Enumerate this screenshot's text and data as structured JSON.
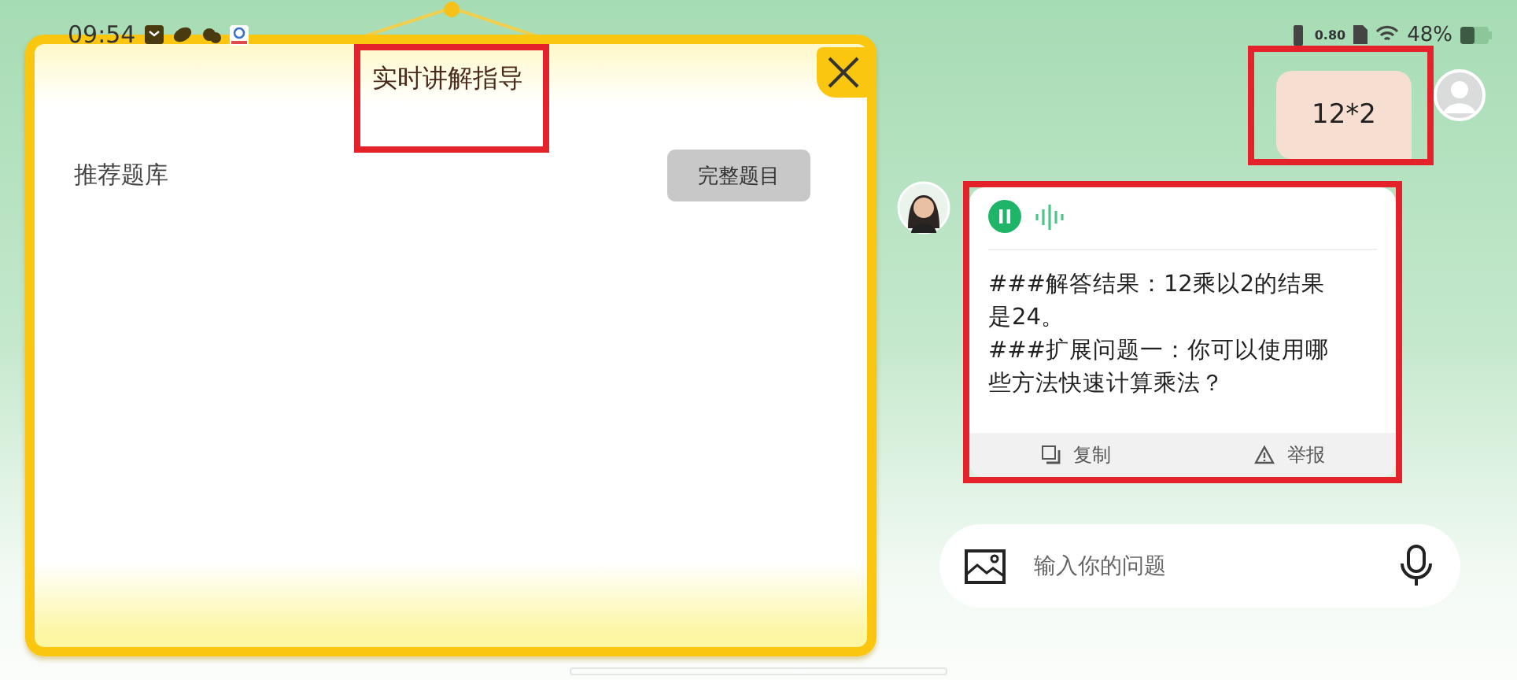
{
  "status_bar": {
    "time": "09:54",
    "speed": "0.80",
    "battery": "48%"
  },
  "popup": {
    "title": "实时讲解指导",
    "title_highlighted": true,
    "section_label": "推荐题库",
    "button": "完整题目"
  },
  "messages": [
    {
      "kind": "user",
      "text": "12*2",
      "highlighted": true
    },
    {
      "kind": "bot",
      "playing": true,
      "text": "###解答结果：12乘以2的结果是24。\n###扩展问题一：你可以使用哪些方法快速计算乘法？",
      "actions": [
        "复制",
        "举报"
      ],
      "highlighted": true
    }
  ],
  "input": {
    "placeholder": "输入你的问题"
  }
}
